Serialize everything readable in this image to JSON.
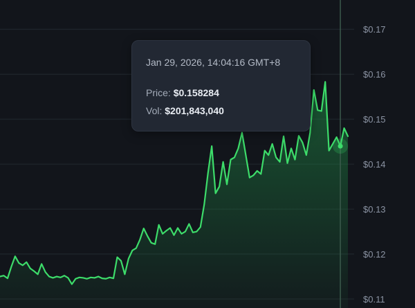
{
  "tooltip": {
    "date": "Jan 29, 2026, 14:04:16 GMT+8",
    "price_label": "Price:",
    "price_value": "$0.158284",
    "vol_label": "Vol:",
    "vol_value": "$201,843,040"
  },
  "colors": {
    "background": "#12151b",
    "line": "#3ddc6a",
    "area_fill": "#1f8a45",
    "gridline": "#232a31",
    "crosshair": "#3b5a4c",
    "tooltip_background": "#222833",
    "axis_label": "#8b93a3"
  },
  "chart_data": {
    "type": "area",
    "title": "",
    "xlabel": "",
    "ylabel": "",
    "y_axis_position": "right",
    "ylim": [
      0.108,
      0.1765
    ],
    "y_tick_labels": [
      "$0.17",
      "$0.16",
      "$0.15",
      "$0.14",
      "$0.13",
      "$0.12",
      "$0.11"
    ],
    "y_ticks": [
      0.17,
      0.16,
      0.15,
      0.14,
      0.13,
      0.12,
      0.11
    ],
    "grid": true,
    "crosshair_index": 90,
    "series": [
      {
        "values": [
          0.115,
          0.1152,
          0.1146,
          0.1172,
          0.1195,
          0.118,
          0.1175,
          0.1182,
          0.1168,
          0.1162,
          0.1155,
          0.1178,
          0.116,
          0.115,
          0.1147,
          0.115,
          0.1148,
          0.1152,
          0.1147,
          0.1133,
          0.1145,
          0.1148,
          0.1147,
          0.1145,
          0.1148,
          0.1147,
          0.115,
          0.1146,
          0.1145,
          0.1148,
          0.1146,
          0.1193,
          0.1185,
          0.1155,
          0.119,
          0.1208,
          0.1213,
          0.1232,
          0.1257,
          0.124,
          0.1225,
          0.1222,
          0.1265,
          0.1245,
          0.1252,
          0.1258,
          0.1242,
          0.1258,
          0.1245,
          0.125,
          0.1267,
          0.1248,
          0.125,
          0.126,
          0.131,
          0.138,
          0.144,
          0.1335,
          0.135,
          0.1405,
          0.1355,
          0.141,
          0.1415,
          0.1435,
          0.147,
          0.142,
          0.137,
          0.1375,
          0.1385,
          0.1378,
          0.143,
          0.142,
          0.1445,
          0.1415,
          0.1405,
          0.1462,
          0.1402,
          0.1435,
          0.141,
          0.1463,
          0.1448,
          0.142,
          0.147,
          0.1565,
          0.152,
          0.1518,
          0.1583,
          0.143,
          0.1445,
          0.146,
          0.144,
          0.148,
          0.1462
        ]
      }
    ]
  }
}
